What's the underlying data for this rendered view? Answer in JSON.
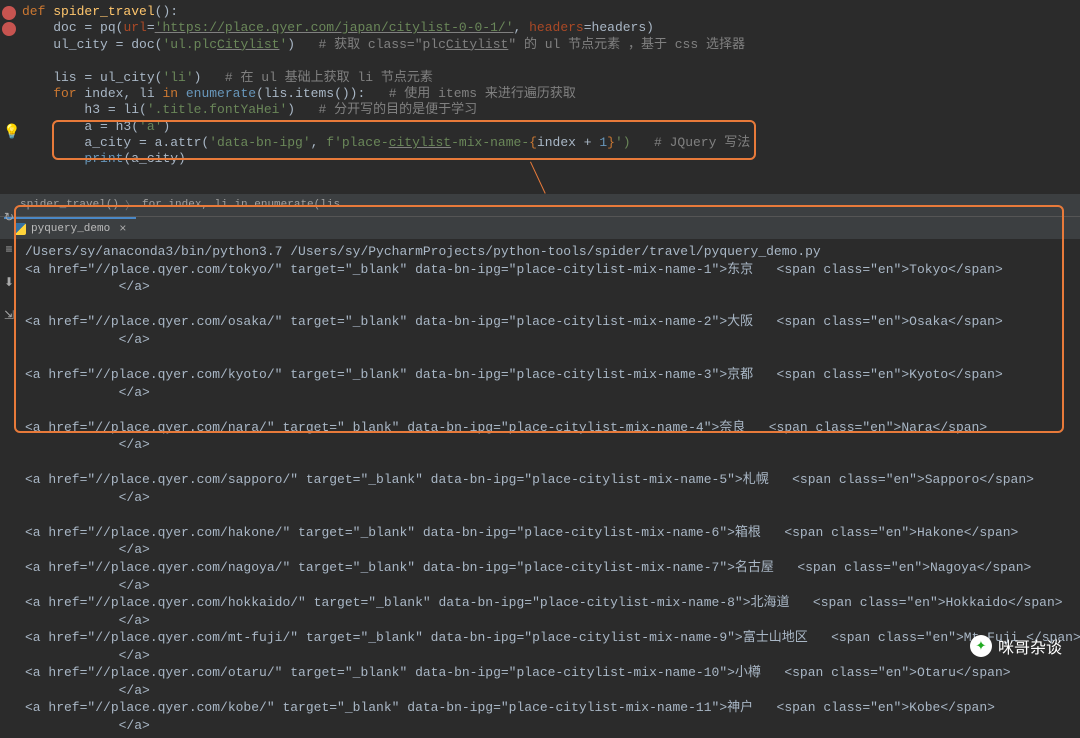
{
  "editor": {
    "def": "def ",
    "fn_name": "spider_travel",
    "paren_open": "():",
    "l2_indent": "    ",
    "doc_eq": "doc = pq(",
    "url_param": "url",
    "eq": "=",
    "url_str": "'https://place.qyer.com/japan/citylist-0-0-1/'",
    "comma": ", ",
    "headers_param": "headers",
    "headers_val": "=headers)",
    "l3": "    ul_city = doc(",
    "l3_str": "'ul.plcCitylist'",
    "l3_end": ")   ",
    "l3_comment": "# 获取 class=\"plcCitylist\" 的 ul 节点元素 ，基于 css 选择器",
    "Citylist": "Citylist",
    "ulplc": "'ul.plc",
    "end_quote": "'",
    "l5": "    lis = ul_city(",
    "l5_str": "'li'",
    "l5_end": ")   ",
    "l5_comment": "# 在 ul 基础上获取 li 节点元素",
    "l6_for": "    for ",
    "l6_vars": "index, li ",
    "l6_in": "in ",
    "l6_enum": "enumerate",
    "l6_args": "(lis.items()):   ",
    "l6_comment": "# 使用 items 来进行遍历获取",
    "l7": "        h3 = li(",
    "l7_str": "'.title.fontYaHei'",
    "l7_end": ")   ",
    "l7_comment": "# 分开写的目的是便于学习",
    "l8": "        a = h3(",
    "l8_str": "'a'",
    "l8_end": ")",
    "l9": "        a_city = a.attr(",
    "l9_str1": "'data-bn-ipg'",
    "l9_comma": ", ",
    "l9_f": "f'place-",
    "l9_city": "citylist",
    "l9_mix": "-mix-name-",
    "l9_brace_o": "{",
    "l9_expr": "index + ",
    "l9_one": "1",
    "l9_brace_c": "}",
    "l9_end": "')   ",
    "l9_comment": "# JQuery 写法",
    "l10": "        print(a_city)"
  },
  "breadcrumb": {
    "item1": "spider_travel()",
    "item2": "for index, li in enumerate(lis...."
  },
  "tab": {
    "name": "pyquery_demo"
  },
  "console": {
    "run_line": "/Users/sy/anaconda3/bin/python3.7 /Users/sy/PycharmProjects/python-tools/spider/travel/pyquery_demo.py",
    "entries": [
      {
        "slug": "tokyo",
        "idx": "1",
        "cn": "东京",
        "en": "Tokyo"
      },
      {
        "slug": "osaka",
        "idx": "2",
        "cn": "大阪",
        "en": "Osaka"
      },
      {
        "slug": "kyoto",
        "idx": "3",
        "cn": "京都",
        "en": "Kyoto"
      },
      {
        "slug": "nara",
        "idx": "4",
        "cn": "奈良",
        "en": "Nara"
      },
      {
        "slug": "sapporo",
        "idx": "5",
        "cn": "札幌",
        "en": "Sapporo"
      },
      {
        "slug": "hakone",
        "idx": "6",
        "cn": "箱根",
        "en": "Hakone"
      },
      {
        "slug": "nagoya",
        "idx": "7",
        "cn": "名古屋",
        "en": "Nagoya"
      },
      {
        "slug": "hokkaido",
        "idx": "8",
        "cn": "北海道",
        "en": "Hokkaido"
      },
      {
        "slug": "mt-fuji",
        "idx": "9",
        "cn": "富士山地区",
        "en": "Mt Fuji "
      },
      {
        "slug": "otaru",
        "idx": "10",
        "cn": "小樽",
        "en": "Otaru"
      },
      {
        "slug": "kobe",
        "idx": "11",
        "cn": "神户",
        "en": "Kobe"
      }
    ],
    "close_a": "            </a>"
  },
  "watermark": "咪哥杂谈"
}
